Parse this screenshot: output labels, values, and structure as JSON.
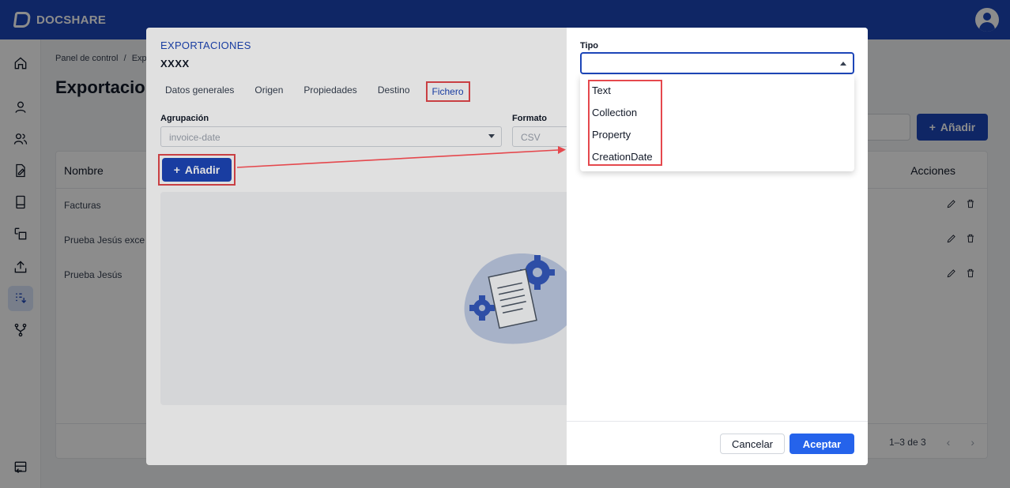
{
  "app": {
    "name": "DOCSHARE"
  },
  "sidebar": {
    "items": [
      {
        "icon": "home-icon"
      },
      {
        "icon": "user-icon"
      },
      {
        "icon": "users-icon"
      },
      {
        "icon": "document-sign-icon"
      },
      {
        "icon": "file-icon"
      },
      {
        "icon": "transfer-icon"
      },
      {
        "icon": "upload-icon"
      },
      {
        "icon": "export-list-icon",
        "active": true
      },
      {
        "icon": "workflow-icon"
      },
      {
        "icon": "logout-icon"
      }
    ]
  },
  "page": {
    "breadcrumb": {
      "root": "Panel de control",
      "sep": "/",
      "current": "Exp"
    },
    "title": "Exportacion",
    "add_label": "Añadir",
    "table": {
      "headers": {
        "name": "Nombre",
        "actions": "Acciones"
      },
      "rows": [
        {
          "name": "Facturas"
        },
        {
          "name": "Prueba Jesús exce"
        },
        {
          "name": "Prueba Jesús"
        }
      ],
      "pagination": "1–3 de 3"
    }
  },
  "dialog": {
    "title": "EXPORTACIONES",
    "subtitle": "XXXX",
    "tabs": [
      "Datos generales",
      "Origen",
      "Propiedades",
      "Destino",
      "Fichero"
    ],
    "active_tab": "Fichero",
    "grouping": {
      "label": "Agrupación",
      "value": "invoice-date"
    },
    "format": {
      "label": "Formato",
      "value": "CSV"
    },
    "add_label": "Añadir"
  },
  "drawer": {
    "type_label": "Tipo",
    "type_value": "",
    "options": [
      "Text",
      "Collection",
      "Property",
      "CreationDate"
    ],
    "cancel_label": "Cancelar",
    "accept_label": "Aceptar"
  },
  "colors": {
    "primary": "#1d46b8",
    "highlight": "#e5484d",
    "accept": "#2563eb"
  }
}
